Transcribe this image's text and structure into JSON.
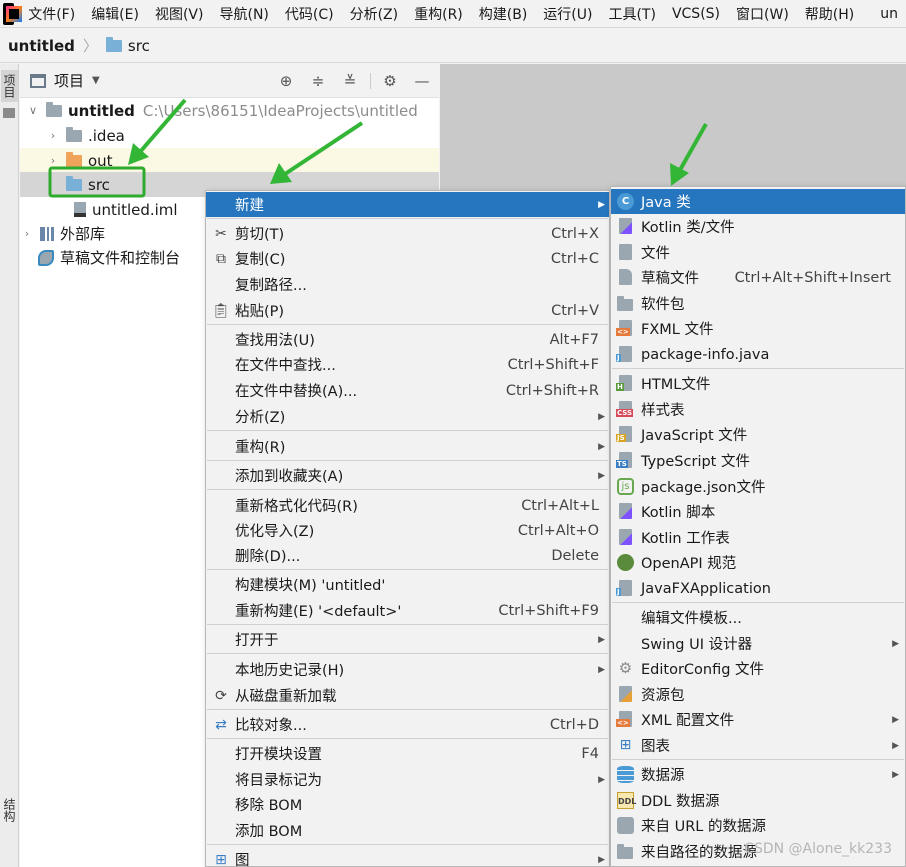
{
  "menubar": {
    "items": [
      "文件(F)",
      "编辑(E)",
      "视图(V)",
      "导航(N)",
      "代码(C)",
      "分析(Z)",
      "重构(R)",
      "构建(B)",
      "运行(U)",
      "工具(T)",
      "VCS(S)",
      "窗口(W)",
      "帮助(H)",
      "un"
    ]
  },
  "breadcrumb": {
    "project": "untitled",
    "folder": "src"
  },
  "left_strip": {
    "top_tab": "项目",
    "bottom_tab": "结构"
  },
  "project_panel": {
    "title": "项目",
    "tree": [
      {
        "label": "untitled",
        "path": "C:\\Users\\86151\\IdeaProjects\\untitled"
      },
      {
        "label": ".idea"
      },
      {
        "label": "out"
      },
      {
        "label": "src"
      },
      {
        "label": "untitled.iml"
      },
      {
        "label": "外部库"
      },
      {
        "label": "草稿文件和控制台"
      }
    ]
  },
  "context_menu": {
    "items": [
      {
        "label": "新建",
        "shortcut": ""
      },
      {
        "label": "剪切(T)",
        "shortcut": "Ctrl+X"
      },
      {
        "label": "复制(C)",
        "shortcut": "Ctrl+C"
      },
      {
        "label": "复制路径...",
        "shortcut": ""
      },
      {
        "label": "粘贴(P)",
        "shortcut": "Ctrl+V"
      },
      {
        "label": "查找用法(U)",
        "shortcut": "Alt+F7"
      },
      {
        "label": "在文件中查找...",
        "shortcut": "Ctrl+Shift+F"
      },
      {
        "label": "在文件中替换(A)...",
        "shortcut": "Ctrl+Shift+R"
      },
      {
        "label": "分析(Z)",
        "shortcut": ""
      },
      {
        "label": "重构(R)",
        "shortcut": ""
      },
      {
        "label": "添加到收藏夹(A)",
        "shortcut": ""
      },
      {
        "label": "重新格式化代码(R)",
        "shortcut": "Ctrl+Alt+L"
      },
      {
        "label": "优化导入(Z)",
        "shortcut": "Ctrl+Alt+O"
      },
      {
        "label": "删除(D)...",
        "shortcut": "Delete"
      },
      {
        "label": "构建模块(M) 'untitled'",
        "shortcut": ""
      },
      {
        "label": "重新构建(E) '<default>'",
        "shortcut": "Ctrl+Shift+F9"
      },
      {
        "label": "打开于",
        "shortcut": ""
      },
      {
        "label": "本地历史记录(H)",
        "shortcut": ""
      },
      {
        "label": "从磁盘重新加载",
        "shortcut": ""
      },
      {
        "label": "比较对象...",
        "shortcut": "Ctrl+D"
      },
      {
        "label": "打开模块设置",
        "shortcut": "F4"
      },
      {
        "label": "将目录标记为",
        "shortcut": ""
      },
      {
        "label": "移除 BOM",
        "shortcut": ""
      },
      {
        "label": "添加 BOM",
        "shortcut": ""
      },
      {
        "label": "图",
        "shortcut": ""
      }
    ]
  },
  "new_submenu": {
    "items": [
      {
        "label": "Java 类",
        "shortcut": ""
      },
      {
        "label": "Kotlin 类/文件",
        "shortcut": ""
      },
      {
        "label": "文件",
        "shortcut": ""
      },
      {
        "label": "草稿文件",
        "shortcut": "Ctrl+Alt+Shift+Insert"
      },
      {
        "label": "软件包",
        "shortcut": ""
      },
      {
        "label": "FXML 文件",
        "shortcut": ""
      },
      {
        "label": "package-info.java",
        "shortcut": ""
      },
      {
        "label": "HTML文件",
        "shortcut": ""
      },
      {
        "label": "样式表",
        "shortcut": ""
      },
      {
        "label": "JavaScript 文件",
        "shortcut": ""
      },
      {
        "label": "TypeScript 文件",
        "shortcut": ""
      },
      {
        "label": "package.json文件",
        "shortcut": ""
      },
      {
        "label": "Kotlin 脚本",
        "shortcut": ""
      },
      {
        "label": "Kotlin 工作表",
        "shortcut": ""
      },
      {
        "label": "OpenAPI 规范",
        "shortcut": ""
      },
      {
        "label": "JavaFXApplication",
        "shortcut": ""
      },
      {
        "label": "编辑文件模板...",
        "shortcut": ""
      },
      {
        "label": "Swing UI 设计器",
        "shortcut": ""
      },
      {
        "label": "EditorConfig 文件",
        "shortcut": ""
      },
      {
        "label": "资源包",
        "shortcut": ""
      },
      {
        "label": "XML 配置文件",
        "shortcut": ""
      },
      {
        "label": "图表",
        "shortcut": ""
      },
      {
        "label": "数据源",
        "shortcut": ""
      },
      {
        "label": "DDL 数据源",
        "shortcut": ""
      },
      {
        "label": "来自 URL 的数据源",
        "shortcut": ""
      },
      {
        "label": "来自路径的数据源",
        "shortcut": ""
      }
    ]
  },
  "icon_tags": {
    "css": "CSS",
    "js": "JS",
    "ts": "TS",
    "html": "H",
    "ddl": "DDL",
    "j": "J",
    "xml": "<>"
  },
  "watermark": "CSDN @Alone_kk233",
  "colors": {
    "selection": "#2675bf",
    "annotation_green": "#33b536",
    "src_highlight": "#2eaa2e"
  }
}
